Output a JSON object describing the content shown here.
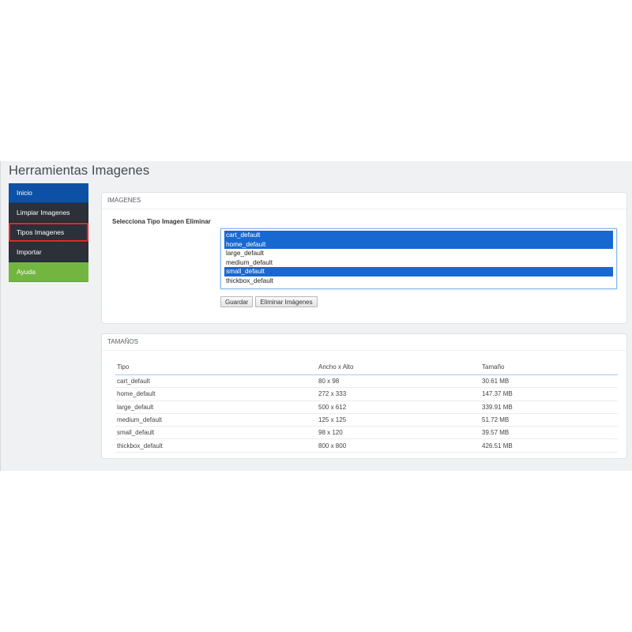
{
  "page_title": "Herramientas Imagenes",
  "sidebar": {
    "items": [
      {
        "label": "Inicio"
      },
      {
        "label": "Limpiar Imagenes"
      },
      {
        "label": "Tipos Imagenes"
      },
      {
        "label": "Importar"
      },
      {
        "label": "Ayuda"
      }
    ],
    "colors": {
      "active": "#0d51a7",
      "default": "#2b3039",
      "help": "#72b53f",
      "highlight_border": "#e4262d"
    }
  },
  "images_panel": {
    "heading": "IMÁGENES",
    "label": "Selecciona Tipo Imagen Eliminar",
    "options": [
      {
        "label": "cart_default",
        "selected": true
      },
      {
        "label": "home_default",
        "selected": true
      },
      {
        "label": "large_default",
        "selected": false
      },
      {
        "label": "medium_default",
        "selected": false
      },
      {
        "label": "small_default",
        "selected": true
      },
      {
        "label": "thickbox_default",
        "selected": false
      }
    ],
    "buttons": {
      "save": "Guardar",
      "delete": "Eliminar Imágenes"
    }
  },
  "sizes_panel": {
    "heading": "TAMAÑOS",
    "columns": [
      "Tipo",
      "Ancho x Alto",
      "Tamaño"
    ],
    "rows": [
      [
        "cart_default",
        "80 x 98",
        "30.61 MB"
      ],
      [
        "home_default",
        "272 x 333",
        "147.37 MB"
      ],
      [
        "large_default",
        "500 x 612",
        "339.91 MB"
      ],
      [
        "medium_default",
        "125 x 125",
        "51.72 MB"
      ],
      [
        "small_default",
        "98 x 120",
        "39.57 MB"
      ],
      [
        "thickbox_default",
        "800 x 800",
        "426.51 MB"
      ]
    ]
  }
}
